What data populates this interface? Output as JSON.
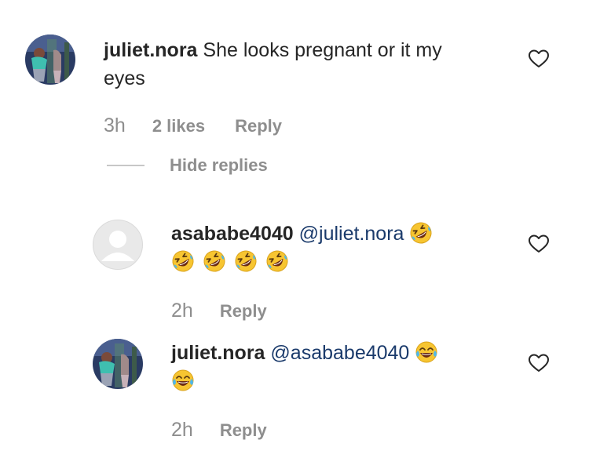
{
  "comments": [
    {
      "username": "juliet.nora",
      "text_line1": "She looks pregnant or it my",
      "text_line2": "eyes",
      "time": "3h",
      "likes": "2 likes",
      "reply_label": "Reply",
      "avatar": "photo-avatar"
    }
  ],
  "hide_replies_label": "Hide replies",
  "replies": [
    {
      "username": "asababe4040",
      "mention": "@juliet.nora",
      "emojis_line1": [
        "rolling-on-floor-laughing-emoji"
      ],
      "emojis_line2": [
        "rolling-on-floor-laughing-emoji",
        "rolling-on-floor-laughing-emoji",
        "rolling-on-floor-laughing-emoji",
        "rolling-on-floor-laughing-emoji"
      ],
      "time": "2h",
      "reply_label": "Reply",
      "avatar": "default-avatar"
    },
    {
      "username": "juliet.nora",
      "mention": "@asababe4040",
      "emojis_line1": [
        "face-with-tears-of-joy-emoji"
      ],
      "emojis_line2": [
        "face-with-tears-of-joy-emoji"
      ],
      "time": "2h",
      "reply_label": "Reply",
      "avatar": "photo-avatar"
    }
  ],
  "colors": {
    "text": "#262626",
    "meta": "#8e8e8e",
    "mention": "#1a3a6b",
    "emoji_yellow": "#f7c531"
  }
}
